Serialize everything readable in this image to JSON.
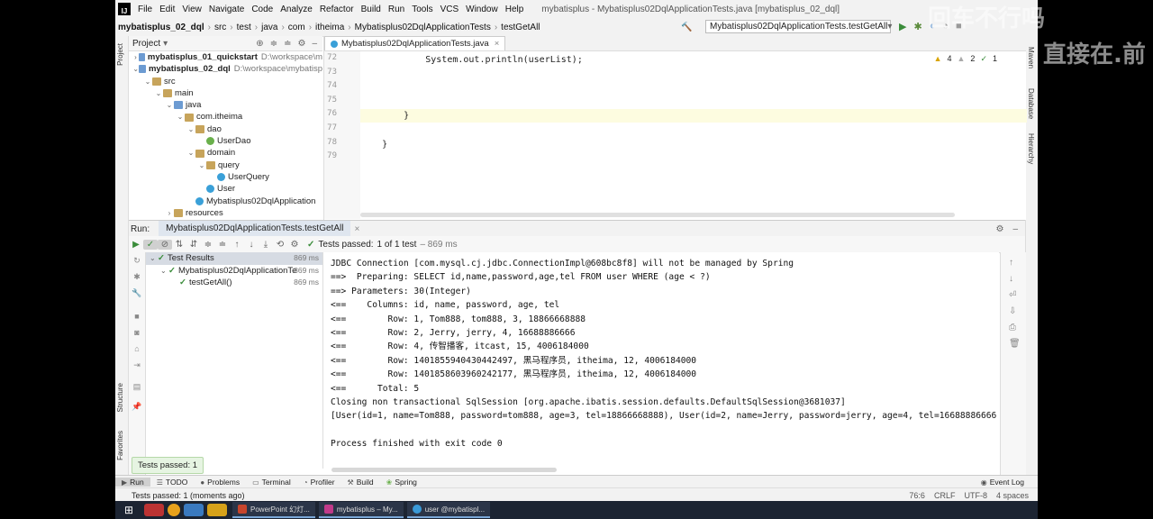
{
  "menu": {
    "items": [
      "File",
      "Edit",
      "View",
      "Navigate",
      "Code",
      "Analyze",
      "Refactor",
      "Build",
      "Run",
      "Tools",
      "VCS",
      "Window",
      "Help"
    ],
    "window_title": "mybatisplus - Mybatisplus02DqlApplicationTests.java [mybatisplus_02_dql]"
  },
  "breadcrumbs": [
    "mybatisplus_02_dql",
    "src",
    "test",
    "java",
    "com",
    "itheima",
    "Mybatisplus02DqlApplicationTests",
    "testGetAll"
  ],
  "run_config": "Mybatisplus02DqlApplicationTests.testGetAll",
  "side_labels": {
    "project": "Project",
    "structure": "Structure",
    "favorites": "Favorites",
    "maven": "Maven",
    "database": "Database",
    "hierarchy": "Hierarchy"
  },
  "project": {
    "header": "Project",
    "tree": [
      {
        "label": "mybatisplus_01_quickstart",
        "path": "D:\\workspace\\m",
        "bold": true,
        "depth": 0,
        "arrow": ">",
        "icon": "fold-b"
      },
      {
        "label": "mybatisplus_02_dql",
        "path": "D:\\workspace\\mybatisp",
        "bold": true,
        "depth": 0,
        "arrow": "v",
        "icon": "fold-b"
      },
      {
        "label": "src",
        "path": "",
        "bold": false,
        "depth": 1,
        "arrow": "v",
        "icon": "fold"
      },
      {
        "label": "main",
        "path": "",
        "bold": false,
        "depth": 2,
        "arrow": "v",
        "icon": "fold"
      },
      {
        "label": "java",
        "path": "",
        "bold": false,
        "depth": 3,
        "arrow": "v",
        "icon": "fold-b"
      },
      {
        "label": "com.itheima",
        "path": "",
        "bold": false,
        "depth": 4,
        "arrow": "v",
        "icon": "fold"
      },
      {
        "label": "dao",
        "path": "",
        "bold": false,
        "depth": 5,
        "arrow": "v",
        "icon": "fold"
      },
      {
        "label": "UserDao",
        "path": "",
        "bold": false,
        "depth": 6,
        "arrow": "",
        "icon": "intf"
      },
      {
        "label": "domain",
        "path": "",
        "bold": false,
        "depth": 5,
        "arrow": "v",
        "icon": "fold"
      },
      {
        "label": "query",
        "path": "",
        "bold": false,
        "depth": 6,
        "arrow": "v",
        "icon": "fold"
      },
      {
        "label": "UserQuery",
        "path": "",
        "bold": false,
        "depth": 7,
        "arrow": "",
        "icon": "cls"
      },
      {
        "label": "User",
        "path": "",
        "bold": false,
        "depth": 6,
        "arrow": "",
        "icon": "cls"
      },
      {
        "label": "Mybatisplus02DqlApplication",
        "path": "",
        "bold": false,
        "depth": 5,
        "arrow": "",
        "icon": "cls"
      },
      {
        "label": "resources",
        "path": "",
        "bold": false,
        "depth": 3,
        "arrow": ">",
        "icon": "fold"
      }
    ]
  },
  "editor": {
    "tab": "Mybatisplus02DqlApplicationTests.java",
    "inspections": {
      "warnings": "4",
      "weak": "2",
      "ok": "1"
    },
    "lines": [
      {
        "n": "72",
        "code": "            System.out.println(userList);",
        "hl": false
      },
      {
        "n": "73",
        "code": "",
        "hl": false
      },
      {
        "n": "74",
        "code": "",
        "hl": false
      },
      {
        "n": "75",
        "code": "",
        "hl": false
      },
      {
        "n": "76",
        "code": "        }",
        "hl": true
      },
      {
        "n": "77",
        "code": "",
        "hl": false
      },
      {
        "n": "78",
        "code": "    }",
        "hl": false
      },
      {
        "n": "79",
        "code": "",
        "hl": false
      }
    ]
  },
  "run": {
    "label": "Run:",
    "tab": "Mybatisplus02DqlApplicationTests.testGetAll",
    "status_prefix": "Tests passed:",
    "status_count": "1 of 1 test",
    "status_time": "– 869 ms",
    "results": [
      {
        "label": "Test Results",
        "time": "869 ms",
        "depth": 0
      },
      {
        "label": "Mybatisplus02DqlApplicationTe",
        "time": "869 ms",
        "depth": 1
      },
      {
        "label": "testGetAll()",
        "time": "869 ms",
        "depth": 2
      }
    ],
    "toast": "Tests passed: 1"
  },
  "console": [
    "JDBC Connection [com.mysql.cj.jdbc.ConnectionImpl@608bc8f8] will not be managed by Spring",
    "==>  Preparing: SELECT id,name,password,age,tel FROM user WHERE (age < ?)",
    "==> Parameters: 30(Integer)",
    "<==    Columns: id, name, password, age, tel",
    "<==        Row: 1, Tom888, tom888, 3, 18866668888",
    "<==        Row: 2, Jerry, jerry, 4, 16688886666",
    "<==        Row: 4, 传智播客, itcast, 15, 4006184000",
    "<==        Row: 1401855940430442497, 黑马程序员, itheima, 12, 4006184000",
    "<==        Row: 1401858603960242177, 黑马程序员, itheima, 12, 4006184000",
    "<==      Total: 5",
    "Closing non transactional SqlSession [org.apache.ibatis.session.defaults.DefaultSqlSession@3681037]",
    "[User(id=1, name=Tom888, password=tom888, age=3, tel=18866668888), User(id=2, name=Jerry, password=jerry, age=4, tel=16688886666",
    "",
    "Process finished with exit code 0"
  ],
  "bottom_tabs": [
    "Run",
    "TODO",
    "Problems",
    "Terminal",
    "Profiler",
    "Build",
    "Spring"
  ],
  "event_log": "Event Log",
  "status": {
    "text": "Tests passed: 1 (moments ago)",
    "pos": "76:6",
    "encoding": "UTF-8",
    "indent": "4 spaces"
  },
  "overlay": [
    "回车不行吗",
    "直接在.前"
  ],
  "taskbar": {
    "apps": [
      "PowerPoint 幻灯...",
      "mybatisplus – My...",
      "user @mybatispl..."
    ]
  }
}
